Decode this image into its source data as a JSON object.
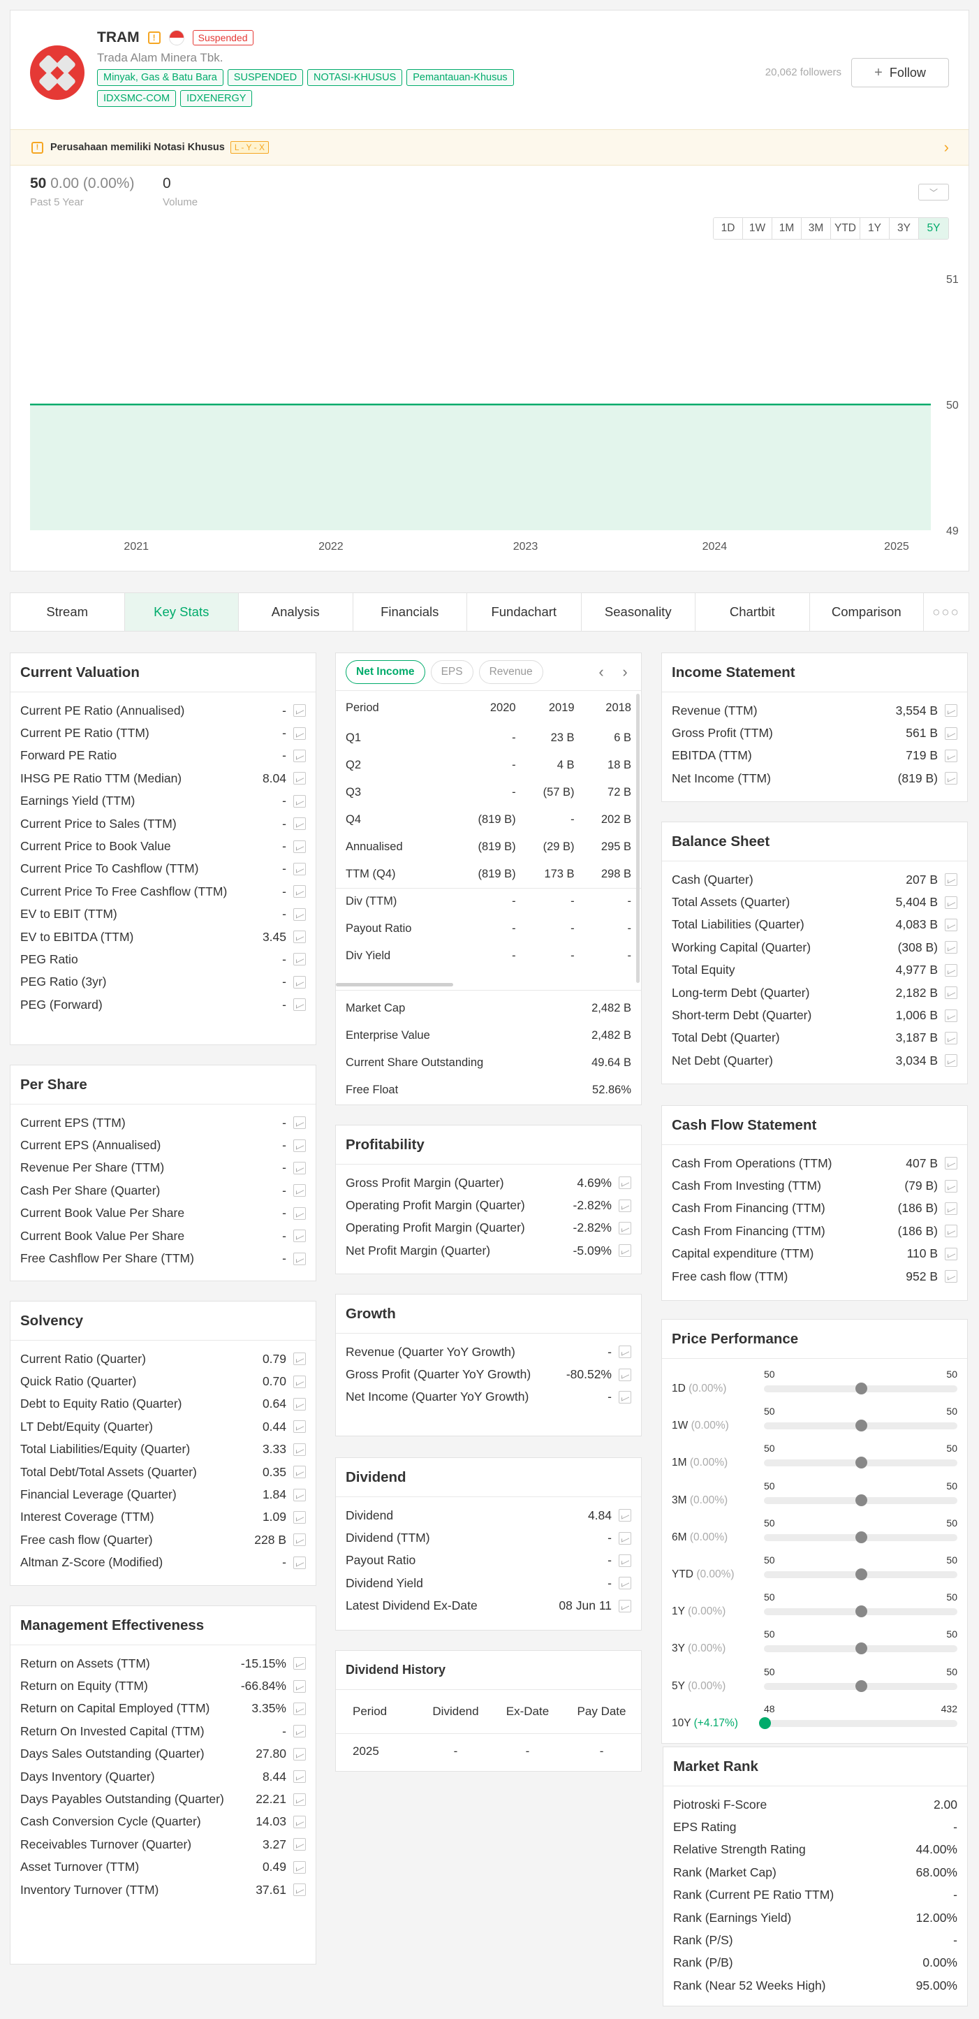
{
  "header": {
    "ticker": "TRAM",
    "status_badge": "Suspended",
    "company_name": "Trada Alam Minera Tbk.",
    "tags": [
      "Minyak, Gas & Batu Bara",
      "SUSPENDED",
      "NOTASI-KHUSUS",
      "Pemantauan-Khusus",
      "IDXSMC-COM",
      "IDXENERGY"
    ],
    "followers": "20,062 followers",
    "follow_label": "Follow",
    "notice_text": "Perusahaan memiliki Notasi Khusus",
    "notasi_code": "L - Y - X"
  },
  "quote": {
    "price": "50",
    "change": "0.00 (0.00%)",
    "period_label": "Past 5 Year",
    "volume": "0",
    "volume_label": "Volume"
  },
  "ranges": [
    "1D",
    "1W",
    "1M",
    "3M",
    "YTD",
    "1Y",
    "3Y",
    "5Y"
  ],
  "active_range": "5Y",
  "chart_data": {
    "type": "area",
    "x_labels": [
      "2021",
      "2022",
      "2023",
      "2024",
      "2025"
    ],
    "y_ticks": [
      "51",
      "50",
      "49"
    ],
    "ylim": [
      49,
      51
    ],
    "x": [
      "2020",
      "2021",
      "2022",
      "2023",
      "2024",
      "2025"
    ],
    "values": [
      50,
      50,
      50,
      50,
      50,
      50
    ],
    "line_color": "#00ab6b",
    "fill_color": "#e3f5ec"
  },
  "tabs": [
    "Stream",
    "Key Stats",
    "Analysis",
    "Financials",
    "Fundachart",
    "Seasonality",
    "Chartbit",
    "Comparison"
  ],
  "active_tab": "Key Stats",
  "current_valuation": {
    "title": "Current Valuation",
    "rows": [
      [
        "Current PE Ratio (Annualised)",
        "-"
      ],
      [
        "Current PE Ratio (TTM)",
        "-"
      ],
      [
        "Forward PE Ratio",
        "-"
      ],
      [
        "IHSG PE Ratio TTM (Median)",
        "8.04"
      ],
      [
        "Earnings Yield (TTM)",
        "-"
      ],
      [
        "Current Price to Sales (TTM)",
        "-"
      ],
      [
        "Current Price to Book Value",
        "-"
      ],
      [
        "Current Price To Cashflow (TTM)",
        "-"
      ],
      [
        "Current Price To Free Cashflow (TTM)",
        "-"
      ],
      [
        "EV to EBIT (TTM)",
        "-"
      ],
      [
        "EV to EBITDA (TTM)",
        "3.45"
      ],
      [
        "PEG Ratio",
        "-"
      ],
      [
        "PEG Ratio (3yr)",
        "-"
      ],
      [
        "PEG (Forward)",
        "-"
      ]
    ]
  },
  "per_share": {
    "title": "Per Share",
    "rows": [
      [
        "Current EPS (TTM)",
        "-"
      ],
      [
        "Current EPS (Annualised)",
        "-"
      ],
      [
        "Revenue Per Share (TTM)",
        "-"
      ],
      [
        "Cash Per Share (Quarter)",
        "-"
      ],
      [
        "Current Book Value Per Share",
        "-"
      ],
      [
        "Current Book Value Per Share",
        "-"
      ],
      [
        "Free Cashflow Per Share (TTM)",
        "-"
      ]
    ]
  },
  "solvency": {
    "title": "Solvency",
    "rows": [
      [
        "Current Ratio (Quarter)",
        "0.79"
      ],
      [
        "Quick Ratio (Quarter)",
        "0.70"
      ],
      [
        "Debt to Equity Ratio (Quarter)",
        "0.64"
      ],
      [
        "LT Debt/Equity (Quarter)",
        "0.44"
      ],
      [
        "Total Liabilities/Equity (Quarter)",
        "3.33"
      ],
      [
        "Total Debt/Total Assets (Quarter)",
        "0.35"
      ],
      [
        "Financial Leverage (Quarter)",
        "1.84"
      ],
      [
        "Interest Coverage (TTM)",
        "1.09"
      ],
      [
        "Free cash flow (Quarter)",
        "228 B"
      ],
      [
        "Altman Z-Score (Modified)",
        "-"
      ]
    ]
  },
  "management": {
    "title": "Management Effectiveness",
    "rows": [
      [
        "Return on Assets (TTM)",
        "-15.15%"
      ],
      [
        "Return on Equity (TTM)",
        "-66.84%"
      ],
      [
        "Return on Capital Employed (TTM)",
        "3.35%"
      ],
      [
        "Return On Invested Capital (TTM)",
        "-"
      ],
      [
        "Days Sales Outstanding (Quarter)",
        "27.80"
      ],
      [
        "Days Inventory (Quarter)",
        "8.44"
      ],
      [
        "Days Payables Outstanding (Quarter)",
        "22.21"
      ],
      [
        "Cash Conversion Cycle (Quarter)",
        "14.03"
      ],
      [
        "Receivables Turnover (Quarter)",
        "3.27"
      ],
      [
        "Asset Turnover (TTM)",
        "0.49"
      ],
      [
        "Inventory Turnover (TTM)",
        "37.61"
      ]
    ]
  },
  "financials": {
    "pills": [
      "Net Income",
      "EPS",
      "Revenue"
    ],
    "active_pill": "Net Income",
    "columns": [
      "Period",
      "2020",
      "2019",
      "2018"
    ],
    "rows": [
      [
        "Q1",
        "-",
        "23 B",
        "6 B"
      ],
      [
        "Q2",
        "-",
        "4 B",
        "18 B"
      ],
      [
        "Q3",
        "-",
        "(57 B)",
        "72 B"
      ],
      [
        "Q4",
        "(819 B)",
        "-",
        "202 B"
      ],
      [
        "Annualised",
        "(819 B)",
        "(29 B)",
        "295 B"
      ],
      [
        "TTM (Q4)",
        "(819 B)",
        "173 B",
        "298 B"
      ],
      [
        "Div (TTM)",
        "-",
        "-",
        "-"
      ],
      [
        "Payout Ratio",
        "-",
        "-",
        "-"
      ],
      [
        "Div Yield",
        "-",
        "-",
        "-"
      ]
    ],
    "footer": [
      [
        "Market Cap",
        "2,482 B"
      ],
      [
        "Enterprise Value",
        "2,482 B"
      ],
      [
        "Current Share Outstanding",
        "49.64 B"
      ],
      [
        "Free Float",
        "52.86%"
      ]
    ]
  },
  "profitability": {
    "title": "Profitability",
    "rows": [
      [
        "Gross Profit Margin (Quarter)",
        "4.69%"
      ],
      [
        "Operating Profit Margin (Quarter)",
        "-2.82%"
      ],
      [
        "Operating Profit Margin (Quarter)",
        "-2.82%"
      ],
      [
        "Net Profit Margin (Quarter)",
        "-5.09%"
      ]
    ]
  },
  "growth": {
    "title": "Growth",
    "rows": [
      [
        "Revenue (Quarter YoY Growth)",
        "-"
      ],
      [
        "Gross Profit (Quarter YoY Growth)",
        "-80.52%"
      ],
      [
        "Net Income (Quarter YoY Growth)",
        "-"
      ]
    ]
  },
  "dividend": {
    "title": "Dividend",
    "rows": [
      [
        "Dividend",
        "4.84"
      ],
      [
        "Dividend (TTM)",
        "-"
      ],
      [
        "Payout Ratio",
        "-"
      ],
      [
        "Dividend Yield",
        "-"
      ],
      [
        "Latest Dividend Ex-Date",
        "08 Jun 11"
      ]
    ]
  },
  "dividend_history": {
    "title": "Dividend History",
    "columns": [
      "Period",
      "Dividend",
      "Ex-Date",
      "Pay Date"
    ],
    "rows": [
      [
        "2025",
        "-",
        "-",
        "-"
      ]
    ]
  },
  "income_statement": {
    "title": "Income Statement",
    "rows": [
      [
        "Revenue (TTM)",
        "3,554 B"
      ],
      [
        "Gross Profit (TTM)",
        "561 B"
      ],
      [
        "EBITDA (TTM)",
        "719 B"
      ],
      [
        "Net Income (TTM)",
        "(819 B)"
      ]
    ]
  },
  "balance_sheet": {
    "title": "Balance Sheet",
    "rows": [
      [
        "Cash (Quarter)",
        "207 B"
      ],
      [
        "Total Assets (Quarter)",
        "5,404 B"
      ],
      [
        "Total Liabilities (Quarter)",
        "4,083 B"
      ],
      [
        "Working Capital (Quarter)",
        "(308 B)"
      ],
      [
        "Total Equity",
        "4,977 B"
      ],
      [
        "Long-term Debt (Quarter)",
        "2,182 B"
      ],
      [
        "Short-term Debt (Quarter)",
        "1,006 B"
      ],
      [
        "Total Debt (Quarter)",
        "3,187 B"
      ],
      [
        "Net Debt (Quarter)",
        "3,034 B"
      ]
    ]
  },
  "cash_flow": {
    "title": "Cash Flow Statement",
    "rows": [
      [
        "Cash From Operations (TTM)",
        "407 B"
      ],
      [
        "Cash From Investing (TTM)",
        "(79 B)"
      ],
      [
        "Cash From Financing (TTM)",
        "(186 B)"
      ],
      [
        "Cash From Financing (TTM)",
        "(186 B)"
      ],
      [
        "Capital expenditure (TTM)",
        "110 B"
      ],
      [
        "Free cash flow (TTM)",
        "952 B"
      ]
    ]
  },
  "price_performance": {
    "title": "Price Performance",
    "rows": [
      {
        "period": "1D",
        "change": "(0.00%)",
        "low": "50",
        "high": "50",
        "position": 0.5,
        "up": false
      },
      {
        "period": "1W",
        "change": "(0.00%)",
        "low": "50",
        "high": "50",
        "position": 0.5,
        "up": false
      },
      {
        "period": "1M",
        "change": "(0.00%)",
        "low": "50",
        "high": "50",
        "position": 0.5,
        "up": false
      },
      {
        "period": "3M",
        "change": "(0.00%)",
        "low": "50",
        "high": "50",
        "position": 0.5,
        "up": false
      },
      {
        "period": "6M",
        "change": "(0.00%)",
        "low": "50",
        "high": "50",
        "position": 0.5,
        "up": false
      },
      {
        "period": "YTD",
        "change": "(0.00%)",
        "low": "50",
        "high": "50",
        "position": 0.5,
        "up": false
      },
      {
        "period": "1Y",
        "change": "(0.00%)",
        "low": "50",
        "high": "50",
        "position": 0.5,
        "up": false
      },
      {
        "period": "3Y",
        "change": "(0.00%)",
        "low": "50",
        "high": "50",
        "position": 0.5,
        "up": false
      },
      {
        "period": "5Y",
        "change": "(0.00%)",
        "low": "50",
        "high": "50",
        "position": 0.5,
        "up": false
      },
      {
        "period": "10Y",
        "change": "(+4.17%)",
        "low": "48",
        "high": "432",
        "position": 0.005,
        "up": true
      }
    ]
  },
  "market_rank": {
    "title": "Market Rank",
    "rows": [
      [
        "Piotroski F-Score",
        "2.00"
      ],
      [
        "EPS Rating",
        "-"
      ],
      [
        "Relative Strength Rating",
        "44.00%"
      ],
      [
        "Rank (Market Cap)",
        "68.00%"
      ],
      [
        "Rank (Current PE Ratio TTM)",
        "-"
      ],
      [
        "Rank (Earnings Yield)",
        "12.00%"
      ],
      [
        "Rank (P/S)",
        "-"
      ],
      [
        "Rank (P/B)",
        "0.00%"
      ],
      [
        "Rank (Near 52 Weeks High)",
        "95.00%"
      ]
    ]
  }
}
